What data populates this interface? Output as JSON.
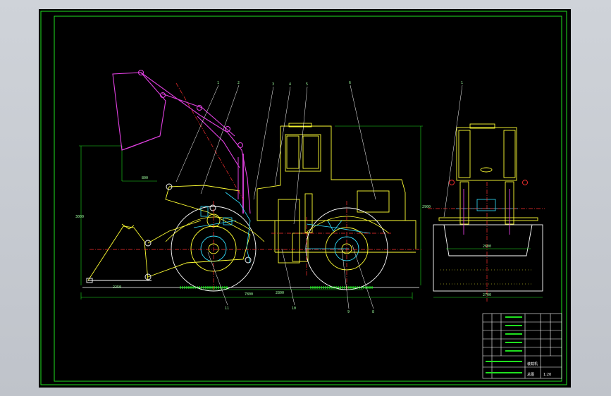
{
  "drawing": {
    "part_callouts": [
      "1",
      "2",
      "3",
      "4",
      "5",
      "6",
      "7"
    ],
    "lower_callouts": [
      "11",
      "10",
      "9",
      "8"
    ],
    "front_view_callout": "1",
    "dims": {
      "overall_length": "7800",
      "wheelbase": "2800",
      "bucket_length": "2250",
      "overall_height": "3000",
      "cab_height": "2900",
      "bucket_height": "800",
      "front_width": "2600",
      "front_bottom_width": "2700"
    },
    "title_block": {
      "title_text": "装载机",
      "code_text": "总图",
      "scale_text": "1:20"
    }
  },
  "colors": {
    "frame": "#1fe01f",
    "yellow": "#ffff33",
    "magenta": "#e040e0",
    "cyan": "#33e0ff",
    "red": "#ff3030",
    "white": "#ffffff"
  }
}
